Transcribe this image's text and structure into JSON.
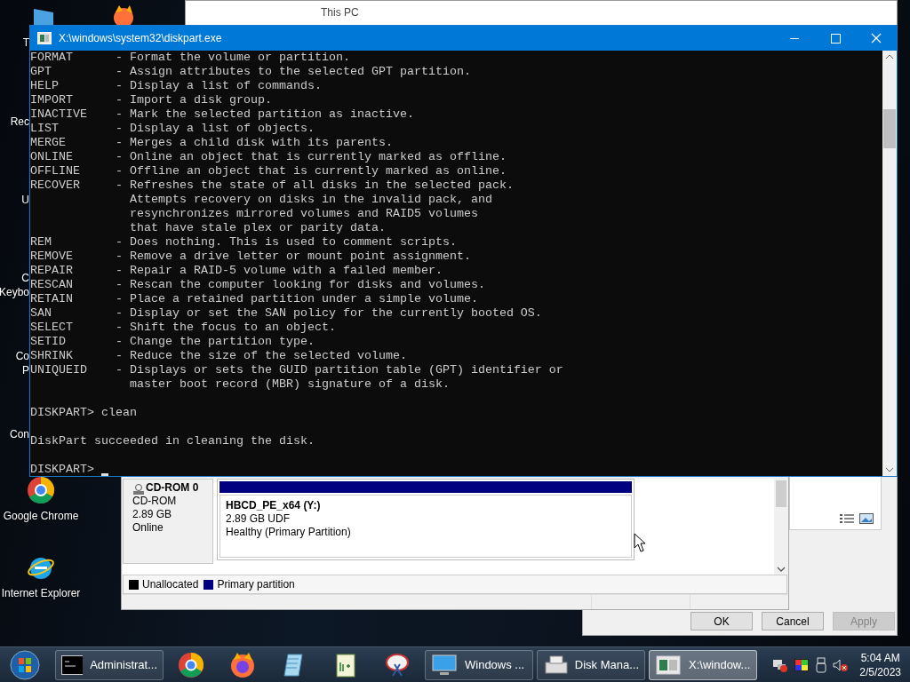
{
  "background_window": {
    "title": "This PC"
  },
  "desktop_labels": [
    {
      "text": "T"
    },
    {
      "text": "Rec"
    },
    {
      "text": "U"
    },
    {
      "text": "C"
    },
    {
      "text": "Keybo"
    },
    {
      "text": "Co"
    },
    {
      "text": "P"
    },
    {
      "text": "Con"
    }
  ],
  "desktop_icons": [
    {
      "label": "Google Chrome"
    },
    {
      "label": "Internet Explorer"
    }
  ],
  "console": {
    "title": "X:\\windows\\system32\\diskpart.exe",
    "blocks": [
      [
        "FORMAT      - Format the volume or partition.",
        "GPT         - Assign attributes to the selected GPT partition.",
        "HELP        - Display a list of commands.",
        "IMPORT      - Import a disk group.",
        "INACTIVE    - Mark the selected partition as inactive.",
        "LIST        - Display a list of objects.",
        "MERGE       - Merges a child disk with its parents.",
        "ONLINE      - Online an object that is currently marked as offline.",
        "OFFLINE     - Offline an object that is currently marked as online.",
        "RECOVER     - Refreshes the state of all disks in the selected pack.",
        "              Attempts recovery on disks in the invalid pack, and",
        "              resynchronizes mirrored volumes and RAID5 volumes",
        "              that have stale plex or parity data.",
        "REM         - Does nothing. This is used to comment scripts.",
        "REMOVE      - Remove a drive letter or mount point assignment.",
        "REPAIR      - Repair a RAID-5 volume with a failed member.",
        "RESCAN      - Rescan the computer looking for disks and volumes.",
        "RETAIN      - Place a retained partition under a simple volume.",
        "SAN         - Display or set the SAN policy for the currently booted OS.",
        "SELECT      - Shift the focus to an object.",
        "SETID       - Change the partition type.",
        "SHRINK      - Reduce the size of the selected volume.",
        "UNIQUEID    - Displays or sets the GUID partition table (GPT) identifier or",
        "              master boot record (MBR) signature of a disk."
      ],
      [
        "DISKPART> clean"
      ],
      [
        "DiskPart succeeded in cleaning the disk."
      ],
      [
        "DISKPART> "
      ]
    ]
  },
  "disk_management": {
    "disk": {
      "name": "CD-ROM 0",
      "type": "CD-ROM",
      "size": "2.89 GB",
      "status": "Online"
    },
    "partition": {
      "name": "HBCD_PE_x64  (Y:)",
      "size": "2.89 GB UDF",
      "status": "Healthy (Primary Partition)"
    },
    "legend": [
      {
        "label": "Unallocated",
        "color": "#000000"
      },
      {
        "label": "Primary partition",
        "color": "#000080"
      }
    ]
  },
  "dialog": {
    "buttons": [
      {
        "label": "OK",
        "disabled": false
      },
      {
        "label": "Cancel",
        "disabled": false
      },
      {
        "label": "Apply",
        "disabled": true
      }
    ]
  },
  "taskbar": {
    "windows": [
      {
        "label": "Administrat...",
        "selected": false
      },
      {
        "label": "Windows ...",
        "selected": false
      },
      {
        "label": "Disk Mana...",
        "selected": false
      },
      {
        "label": "X:\\window...",
        "selected": true
      }
    ],
    "clock": {
      "time": "5:04 AM",
      "date": "2/5/2023"
    }
  }
}
